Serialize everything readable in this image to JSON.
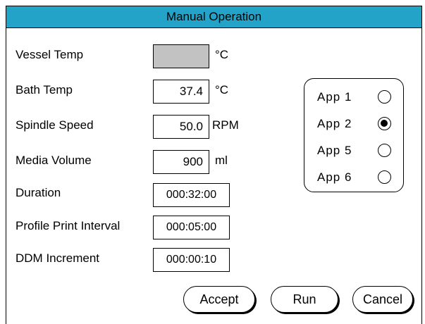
{
  "window": {
    "title": "Manual Operation"
  },
  "fields": {
    "vessel_temp": {
      "label": "Vessel Temp",
      "value": "",
      "unit": "°C"
    },
    "bath_temp": {
      "label": "Bath Temp",
      "value": "37.4",
      "unit": "°C"
    },
    "spindle_speed": {
      "label": "Spindle Speed",
      "value": "50.0",
      "unit": "RPM"
    },
    "media_volume": {
      "label": "Media Volume",
      "value": "900",
      "unit": "ml"
    },
    "duration": {
      "label": "Duration",
      "value": "000:32:00"
    },
    "profile_print_interval": {
      "label": "Profile Print Interval",
      "value": "000:05:00"
    },
    "ddm_increment": {
      "label": "DDM Increment",
      "value": "000:00:10"
    }
  },
  "apps": [
    {
      "label": "App 1",
      "selected": false
    },
    {
      "label": "App 2",
      "selected": true
    },
    {
      "label": "App 5",
      "selected": false
    },
    {
      "label": "App 6",
      "selected": false
    }
  ],
  "buttons": {
    "accept": "Accept",
    "run": "Run",
    "cancel": "Cancel"
  },
  "colors": {
    "titlebar": "#23a3c7",
    "empty_field": "#c2c2c2"
  }
}
